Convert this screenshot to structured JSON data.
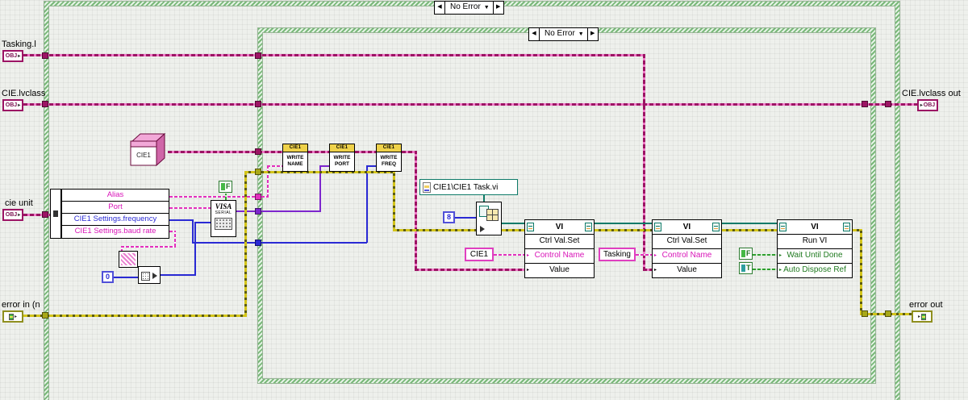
{
  "icons": {
    "left_arrow": "◀",
    "right_arrow": "▶",
    "down_arrow": "▼",
    "bullet": "▸"
  },
  "colors": {
    "class_wire": "#9c1464",
    "string_wire": "#e230bd",
    "numeric_wire": "#2a2ad4",
    "visa_wire": "#7d26cd",
    "error_wire": "#b5a51a",
    "boolean_wire": "#2f9e2f",
    "refnum_wire": "#0e7a68",
    "case_border": "#79b879"
  },
  "outer_case": {
    "label": "No Error"
  },
  "inner_case": {
    "label": "No Error"
  },
  "terminals": {
    "tasking_in": {
      "label": "Tasking.l",
      "glyph": "OBJ"
    },
    "cie_in": {
      "label": "CIE.lvclass",
      "glyph": "OBJ"
    },
    "cie_unit": {
      "label": "cie unit",
      "glyph": "OBJ"
    },
    "error_in": {
      "label": "error in (n"
    },
    "cie_out": {
      "label": "CIE.lvclass out",
      "glyph": "OBJ"
    },
    "error_out": {
      "label": "error out"
    }
  },
  "class_cube": {
    "label": "CIE1"
  },
  "unbundle": {
    "fields": [
      {
        "name": "Alias"
      },
      {
        "name": "Port"
      },
      {
        "name": "CIE1 Settings.frequency"
      },
      {
        "name": "CIE1 Settings.baud rate"
      }
    ]
  },
  "visa_node": {
    "line1": "VISA",
    "line2": "SERIAL"
  },
  "write_nodes": [
    {
      "banner": "CIE1",
      "line1": "WRITE",
      "line2": "NAME"
    },
    {
      "banner": "CIE1",
      "line1": "WRITE",
      "line2": "PORT"
    },
    {
      "banner": "CIE1",
      "line1": "WRITE",
      "line2": "FREQ"
    }
  ],
  "constants": {
    "scan_offset": "0",
    "open_options": "8",
    "visa_flow_control": "F",
    "wait_until_done": "F",
    "auto_dispose_ref": "T",
    "control_name_1": "CIE1",
    "control_name_2": "Tasking",
    "vi_path": "CIE1\\CIE1 Task.vi"
  },
  "invoke_nodes": [
    {
      "header": "VI",
      "method": "Ctrl Val.Set",
      "param1": "Control Name",
      "param2": "Value"
    },
    {
      "header": "VI",
      "method": "Ctrl Val.Set",
      "param1": "Control Name",
      "param2": "Value"
    },
    {
      "header": "VI",
      "method": "Run VI",
      "param1": "Wait Until Done",
      "param2": "Auto Dispose Ref"
    }
  ]
}
